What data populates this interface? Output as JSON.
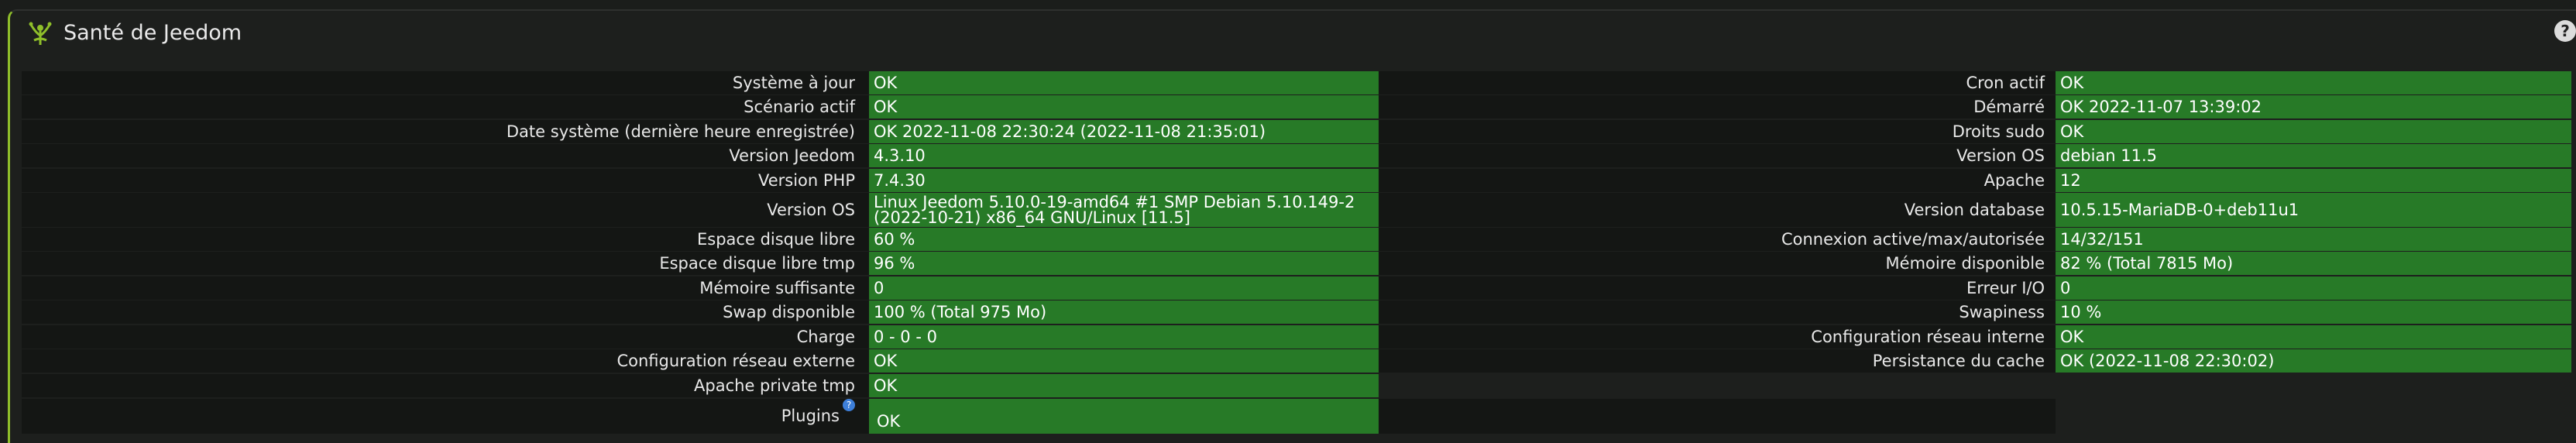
{
  "header": {
    "title": "Santé de Jeedom",
    "help_icon": "help-icon"
  },
  "left_rows": [
    {
      "label": "Système à jour",
      "value": "OK"
    },
    {
      "label": "Scénario actif",
      "value": "OK"
    },
    {
      "label": "Date système (dernière heure enregistrée)",
      "value": "OK 2022-11-08 22:30:24 (2022-11-08 21:35:01)"
    },
    {
      "label": "Version Jeedom",
      "value": "4.3.10"
    },
    {
      "label": "Version PHP",
      "value": "7.4.30"
    },
    {
      "label": "Version OS",
      "value": "Linux Jeedom 5.10.0-19-amd64 #1 SMP Debian 5.10.149-2 (2022-10-21) x86_64 GNU/Linux [11.5]"
    },
    {
      "label": "Espace disque libre",
      "value": "60 %"
    },
    {
      "label": "Espace disque libre tmp",
      "value": "96 %"
    },
    {
      "label": "Mémoire suffisante",
      "value": "0"
    },
    {
      "label": "Swap disponible",
      "value": "100 % (Total 975 Mo)"
    },
    {
      "label": "Charge",
      "value": "0 - 0 - 0"
    },
    {
      "label": "Configuration réseau externe",
      "value": "OK"
    },
    {
      "label": "Apache private tmp",
      "value": "OK"
    },
    {
      "label": "Plugins",
      "value": "OK"
    }
  ],
  "right_rows": [
    {
      "label": "Cron actif",
      "value": "OK"
    },
    {
      "label": "Démarré",
      "value": "OK 2022-11-07 13:39:02"
    },
    {
      "label": "Droits sudo",
      "value": "OK"
    },
    {
      "label": "Version OS",
      "value": "debian 11.5"
    },
    {
      "label": "Apache",
      "value": "12"
    },
    {
      "label": "Version database",
      "value": "10.5.15-MariaDB-0+deb11u1"
    },
    {
      "label": "Connexion active/max/autorisée",
      "value": "14/32/151"
    },
    {
      "label": "Mémoire disponible",
      "value": "82 % (Total 7815 Mo)"
    },
    {
      "label": "Erreur I/O",
      "value": "0"
    },
    {
      "label": "Swapiness",
      "value": "10 %"
    },
    {
      "label": "Configuration réseau interne",
      "value": "OK"
    },
    {
      "label": "Persistance du cache",
      "value": "OK (2022-11-08 22:30:02)"
    }
  ],
  "plugins_help_glyph": "?"
}
